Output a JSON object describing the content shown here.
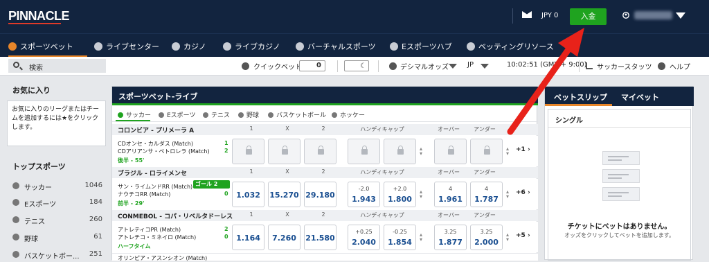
{
  "header": {
    "logo": "PINNACLE",
    "balance": "JPY 0",
    "deposit_label": "入金"
  },
  "nav": {
    "items": [
      {
        "label": "スポーツベット",
        "icon": "soccer-ball-icon"
      },
      {
        "label": "ライブセンター",
        "icon": "live-icon"
      },
      {
        "label": "カジノ",
        "icon": "casino-icon"
      },
      {
        "label": "ライブカジノ",
        "icon": "roulette-icon"
      },
      {
        "label": "バーチャルスポーツ",
        "icon": "virtual-icon"
      },
      {
        "label": "Eスポーツハブ",
        "icon": "headset-icon"
      },
      {
        "label": "ベッティングリソース",
        "icon": "book-icon"
      }
    ]
  },
  "toolbar": {
    "search_label": "検索",
    "quick_bet": "クイックベット",
    "quick_bet_value": "0",
    "odds_format": "デシマルオッズ",
    "language": "JP",
    "clock": "10:02:51 (GMT + 9:00)",
    "soccer_stats": "サッカースタッツ",
    "help": "ヘルプ"
  },
  "favorites": {
    "title": "お気に入り",
    "text": "お気に入りのリーグまたはチームを追加するには★をクリックします。"
  },
  "top_sports": {
    "title": "トップスポーツ",
    "items": [
      {
        "name": "サッカー",
        "count": "1046"
      },
      {
        "name": "Eスポーツ",
        "count": "184"
      },
      {
        "name": "テニス",
        "count": "260"
      },
      {
        "name": "野球",
        "count": "61"
      },
      {
        "name": "バスケットボー...",
        "count": "251"
      }
    ]
  },
  "live": {
    "title": "スポーツベット-ライブ",
    "tabs": [
      "サッカー",
      "Eスポーツ",
      "テニス",
      "野球",
      "バスケットボール",
      "ホッケー"
    ],
    "col_1": "1",
    "col_x": "X",
    "col_2": "2",
    "col_handicap": "ハンディキャップ",
    "col_over": "オーバー",
    "col_under": "アンダー",
    "leagues": [
      {
        "name": "コロンビア - プリメーラ A",
        "match": {
          "home": "CDオンセ・カルダス (Match)",
          "away": "CDアリアンサ・ペトロレラ (Match)",
          "home_score": "1",
          "away_score": "2",
          "time": "後半 - 55'",
          "more": "+1"
        }
      },
      {
        "name": "ブラジル - ロライメンセ",
        "goal": "ゴール 2",
        "match": {
          "home": "サン・ライムンドRR (Match)",
          "away": "ナウチコRR (Match)",
          "home_score": "2",
          "away_score": "0",
          "time": "前半 - 29'",
          "o1": "1.032",
          "ox": "15.270",
          "o2": "29.180",
          "h1_line": "-2.0",
          "h1_odd": "1.943",
          "h2_line": "+2.0",
          "h2_odd": "1.800",
          "ov_line": "4",
          "ov_odd": "1.961",
          "un_line": "4",
          "un_odd": "1.787",
          "more": "+6"
        }
      },
      {
        "name": "CONMEBOL - コパ・リベルタドーレス",
        "match": {
          "home": "アトレティコPR (Match)",
          "away": "アトレチコ・ミネイロ (Match)",
          "home_score": "2",
          "away_score": "0",
          "time": "ハーフタイム",
          "o1": "1.164",
          "ox": "7.260",
          "o2": "21.580",
          "h1_line": "+0.25",
          "h1_odd": "2.040",
          "h2_line": "-0.25",
          "h2_odd": "1.854",
          "ov_line": "3.25",
          "ov_odd": "1.877",
          "un_line": "3.25",
          "un_odd": "2.000",
          "more": "+5"
        }
      }
    ],
    "next_match": "オリンピア・アスンシオン (Match)"
  },
  "betslip": {
    "tab_slip": "ベットスリップ",
    "tab_mybets": "マイベット",
    "single": "シングル",
    "empty_title": "チケットにベットはありません。",
    "empty_sub": "オッズをクリックしてベットを追加します。"
  }
}
